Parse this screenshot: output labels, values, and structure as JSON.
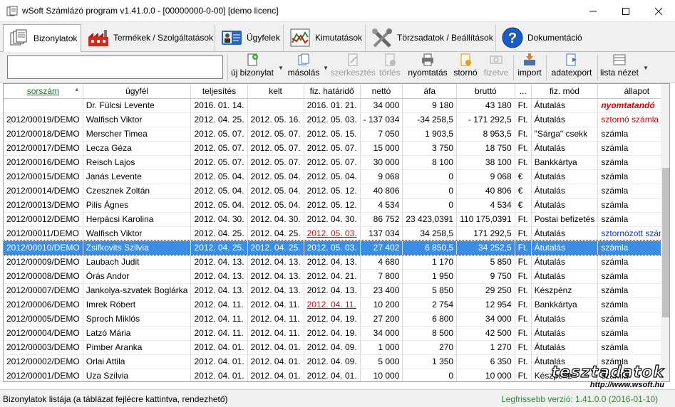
{
  "window": {
    "title": "wSoft Számlázó program v1.41.0.0 - [00000000-0-00] [demo licenc]"
  },
  "tabs": [
    {
      "label": "Bizonylatok",
      "icon": "documents-icon",
      "active": true
    },
    {
      "label": "Termékek / Szolgáltatások",
      "icon": "factory-icon",
      "active": false
    },
    {
      "label": "Ügyfelek",
      "icon": "person-card-icon",
      "active": false
    },
    {
      "label": "Kimutatások",
      "icon": "chart-icon",
      "active": false
    },
    {
      "label": "Törzsadatok / Beállítások",
      "icon": "tools-icon",
      "active": false
    },
    {
      "label": "Dokumentáció",
      "icon": "help-icon",
      "active": false
    }
  ],
  "toolbar": {
    "search_value": "",
    "buttons": {
      "new": "új bizonylat",
      "copy": "másolás",
      "edit": "szerkesztés",
      "delete": "törlés",
      "print": "nyomtatás",
      "storno": "stornó",
      "paid": "fizetve",
      "import": "import",
      "export": "adatexport",
      "listview": "lista nézet"
    }
  },
  "table": {
    "headers": [
      "sorszám",
      "ügyfél",
      "teljesítés",
      "kelt",
      "fiz. határidő",
      "nettó",
      "áfa",
      "bruttó",
      "...",
      "fiz. mód",
      "állapot"
    ],
    "rows": [
      {
        "sorszam": "",
        "ugyfel": "Dr. Fülcsi Levente",
        "teljesites": "2016. 01. 14.",
        "kelt": "",
        "hatarido": "2016. 01. 21.",
        "netto": "34 000",
        "afa": "9 180",
        "brutto": "43 180",
        "penznem": "Ft.",
        "fizmod": "Átutalás",
        "allapot": "nyomtatandó",
        "status_color": "#e00000",
        "status_style": "bold-italic",
        "overdue": false,
        "selected": false
      },
      {
        "sorszam": "2012/00019/DEMO",
        "ugyfel": "Walfisch Viktor",
        "teljesites": "2012. 04. 25.",
        "kelt": "2012. 05. 16.",
        "hatarido": "2012. 05. 03.",
        "netto": "- 137 034",
        "afa": "-34 258,5",
        "brutto": "- 171 292,5",
        "penznem": "Ft.",
        "fizmod": "Átutalás",
        "allapot": "sztornó számla",
        "status_color": "#c00000",
        "status_style": "normal",
        "overdue": false,
        "selected": false
      },
      {
        "sorszam": "2012/00018/DEMO",
        "ugyfel": "Merscher Timea",
        "teljesites": "2012. 05. 07.",
        "kelt": "2012. 05. 07.",
        "hatarido": "2012. 05. 15.",
        "netto": "7 050",
        "afa": "1 903,5",
        "brutto": "8 953,5",
        "penznem": "Ft.",
        "fizmod": "\"Sárga\" csekk",
        "allapot": "számla",
        "status_color": "#000000",
        "status_style": "normal",
        "overdue": false,
        "selected": false
      },
      {
        "sorszam": "2012/00017/DEMO",
        "ugyfel": "Lecza Géza",
        "teljesites": "2012. 05. 07.",
        "kelt": "2012. 05. 07.",
        "hatarido": "2012. 05. 07.",
        "netto": "15 000",
        "afa": "3 750",
        "brutto": "18 750",
        "penznem": "Ft.",
        "fizmod": "Átutalás",
        "allapot": "számla",
        "status_color": "#000000",
        "status_style": "normal",
        "overdue": false,
        "selected": false
      },
      {
        "sorszam": "2012/00016/DEMO",
        "ugyfel": "Reisch Lajos",
        "teljesites": "2012. 05. 07.",
        "kelt": "2012. 05. 07.",
        "hatarido": "2012. 05. 07.",
        "netto": "30 000",
        "afa": "8 100",
        "brutto": "38 100",
        "penznem": "Ft.",
        "fizmod": "Bankkártya",
        "allapot": "számla",
        "status_color": "#000000",
        "status_style": "normal",
        "overdue": false,
        "selected": false
      },
      {
        "sorszam": "2012/00015/DEMO",
        "ugyfel": "Janás Levente",
        "teljesites": "2012. 05. 04.",
        "kelt": "2012. 05. 04.",
        "hatarido": "2012. 05. 04.",
        "netto": "9 068",
        "afa": "0",
        "brutto": "9 068",
        "penznem": "€",
        "fizmod": "Átutalás",
        "allapot": "számla",
        "status_color": "#000000",
        "status_style": "normal",
        "overdue": false,
        "selected": false
      },
      {
        "sorszam": "2012/00014/DEMO",
        "ugyfel": "Czesznek Zoltán",
        "teljesites": "2012. 05. 04.",
        "kelt": "2012. 05. 04.",
        "hatarido": "2012. 05. 12.",
        "netto": "40 806",
        "afa": "0",
        "brutto": "40 806",
        "penznem": "€",
        "fizmod": "Átutalás",
        "allapot": "számla",
        "status_color": "#000000",
        "status_style": "normal",
        "overdue": false,
        "selected": false
      },
      {
        "sorszam": "2012/00013/DEMO",
        "ugyfel": "Pilis Ágnes",
        "teljesites": "2012. 05. 04.",
        "kelt": "2012. 05. 04.",
        "hatarido": "2012. 05. 12.",
        "netto": "4 534",
        "afa": "0",
        "brutto": "4 534",
        "penznem": "€",
        "fizmod": "Átutalás",
        "allapot": "számla",
        "status_color": "#000000",
        "status_style": "normal",
        "overdue": false,
        "selected": false
      },
      {
        "sorszam": "2012/00012/DEMO",
        "ugyfel": "Herpácsi Karolina",
        "teljesites": "2012. 04. 30.",
        "kelt": "2012. 04. 30.",
        "hatarido": "2012. 04. 30.",
        "netto": "86 752",
        "afa": "23 423,0391",
        "brutto": "110 175,0391",
        "penznem": "Ft.",
        "fizmod": "Postai befizetés",
        "allapot": "számla",
        "status_color": "#000000",
        "status_style": "normal",
        "overdue": false,
        "selected": false
      },
      {
        "sorszam": "2012/00011/DEMO",
        "ugyfel": "Walfisch Viktor",
        "teljesites": "2012. 04. 25.",
        "kelt": "2012. 04. 25.",
        "hatarido": "2012. 05. 03.",
        "netto": "137 034",
        "afa": "34 258,5",
        "brutto": "171 292,5",
        "penznem": "Ft.",
        "fizmod": "Átutalás",
        "allapot": "sztornózott számla",
        "status_color": "#1030c0",
        "status_style": "normal",
        "overdue": true,
        "selected": false
      },
      {
        "sorszam": "2012/00010/DEMO",
        "ugyfel": "Zsifkovits Szilvia",
        "teljesites": "2012. 04. 25.",
        "kelt": "2012. 04. 25.",
        "hatarido": "2012. 05. 03.",
        "netto": "27 402",
        "afa": "6 850,5",
        "brutto": "34 252,5",
        "penznem": "Ft.",
        "fizmod": "Átutalás",
        "allapot": "számla",
        "status_color": "#000000",
        "status_style": "normal",
        "overdue": false,
        "selected": true
      },
      {
        "sorszam": "2012/00009/DEMO",
        "ugyfel": "Laubach Judit",
        "teljesites": "2012. 04. 13.",
        "kelt": "2012. 04. 13.",
        "hatarido": "2012. 04. 13.",
        "netto": "4 680",
        "afa": "1 170",
        "brutto": "5 850",
        "penznem": "Ft.",
        "fizmod": "Átutalás",
        "allapot": "számla",
        "status_color": "#000000",
        "status_style": "normal",
        "overdue": false,
        "selected": false
      },
      {
        "sorszam": "2012/00008/DEMO",
        "ugyfel": "Órás Andor",
        "teljesites": "2012. 04. 13.",
        "kelt": "2012. 04. 13.",
        "hatarido": "2012. 04. 21.",
        "netto": "7 800",
        "afa": "1 950",
        "brutto": "9 750",
        "penznem": "Ft.",
        "fizmod": "Átutalás",
        "allapot": "számla",
        "status_color": "#000000",
        "status_style": "normal",
        "overdue": false,
        "selected": false
      },
      {
        "sorszam": "2012/00007/DEMO",
        "ugyfel": "Jankolya-szvatek Boglárka",
        "teljesites": "2012. 04. 13.",
        "kelt": "2012. 04. 13.",
        "hatarido": "2012. 04. 13.",
        "netto": "23 400",
        "afa": "5 850",
        "brutto": "29 250",
        "penznem": "Ft.",
        "fizmod": "Készpénz",
        "allapot": "számla",
        "status_color": "#000000",
        "status_style": "normal",
        "overdue": false,
        "selected": false
      },
      {
        "sorszam": "2012/00006/DEMO",
        "ugyfel": "Imrek Róbert",
        "teljesites": "2012. 04. 11.",
        "kelt": "2012. 04. 11.",
        "hatarido": "2012. 04. 11.",
        "netto": "10 200",
        "afa": "2 754",
        "brutto": "12 954",
        "penznem": "Ft.",
        "fizmod": "Bankkártya",
        "allapot": "számla",
        "status_color": "#000000",
        "status_style": "normal",
        "overdue": true,
        "selected": false
      },
      {
        "sorszam": "2012/00005/DEMO",
        "ugyfel": "Sproch Miklós",
        "teljesites": "2012. 04. 11.",
        "kelt": "2012. 04. 11.",
        "hatarido": "2012. 04. 19.",
        "netto": "27 200",
        "afa": "6 800",
        "brutto": "34 000",
        "penznem": "Ft.",
        "fizmod": "Átutalás",
        "allapot": "számla",
        "status_color": "#000000",
        "status_style": "normal",
        "overdue": false,
        "selected": false
      },
      {
        "sorszam": "2012/00004/DEMO",
        "ugyfel": "Latzó Mária",
        "teljesites": "2012. 04. 11.",
        "kelt": "2012. 04. 11.",
        "hatarido": "2012. 04. 19.",
        "netto": "34 000",
        "afa": "8 500",
        "brutto": "42 500",
        "penznem": "Ft.",
        "fizmod": "Átutalás",
        "allapot": "számla",
        "status_color": "#000000",
        "status_style": "normal",
        "overdue": false,
        "selected": false
      },
      {
        "sorszam": "2012/00003/DEMO",
        "ugyfel": "Pimber Aranka",
        "teljesites": "2012. 04. 01.",
        "kelt": "2012. 04. 01.",
        "hatarido": "2012. 04. 09.",
        "netto": "1 000",
        "afa": "270",
        "brutto": "1 270",
        "penznem": "Ft.",
        "fizmod": "Átutalás",
        "allapot": "számla",
        "status_color": "#000000",
        "status_style": "normal",
        "overdue": false,
        "selected": false
      },
      {
        "sorszam": "2012/00002/DEMO",
        "ugyfel": "Orlai Attila",
        "teljesites": "2012. 04. 01.",
        "kelt": "2012. 04. 01.",
        "hatarido": "2012. 04. 09.",
        "netto": "5 000",
        "afa": "1 350",
        "brutto": "6 350",
        "penznem": "Ft.",
        "fizmod": "Átutalás",
        "allapot": "számla",
        "status_color": "#000000",
        "status_style": "normal",
        "overdue": false,
        "selected": false
      },
      {
        "sorszam": "2012/00001/DEMO",
        "ugyfel": "Uza Szilvia",
        "teljesites": "2012. 04. 01.",
        "kelt": "2012. 04. 01.",
        "hatarido": "2012. 04. 01.",
        "netto": "10 000",
        "afa": "0",
        "brutto": "10 000",
        "penznem": "Ft.",
        "fizmod": "Készpénz",
        "allapot": "számla",
        "status_color": "#000000",
        "status_style": "normal",
        "overdue": false,
        "selected": false
      }
    ]
  },
  "statusbar": {
    "left": "Bizonylatok listája (a táblázat fejlécre kattintva, rendezhető)",
    "right": "Legfrissebb verzió: 1.41.0.0 (2016-01-10)"
  },
  "watermark": {
    "big": "tesztadatok",
    "url": "http://www.wsoft.hu"
  },
  "colors": {
    "selection": "#3a8ee6",
    "overdue_date": "#e00000",
    "sort_header": "#0a7a2a",
    "version_text": "#2a8a2a"
  }
}
